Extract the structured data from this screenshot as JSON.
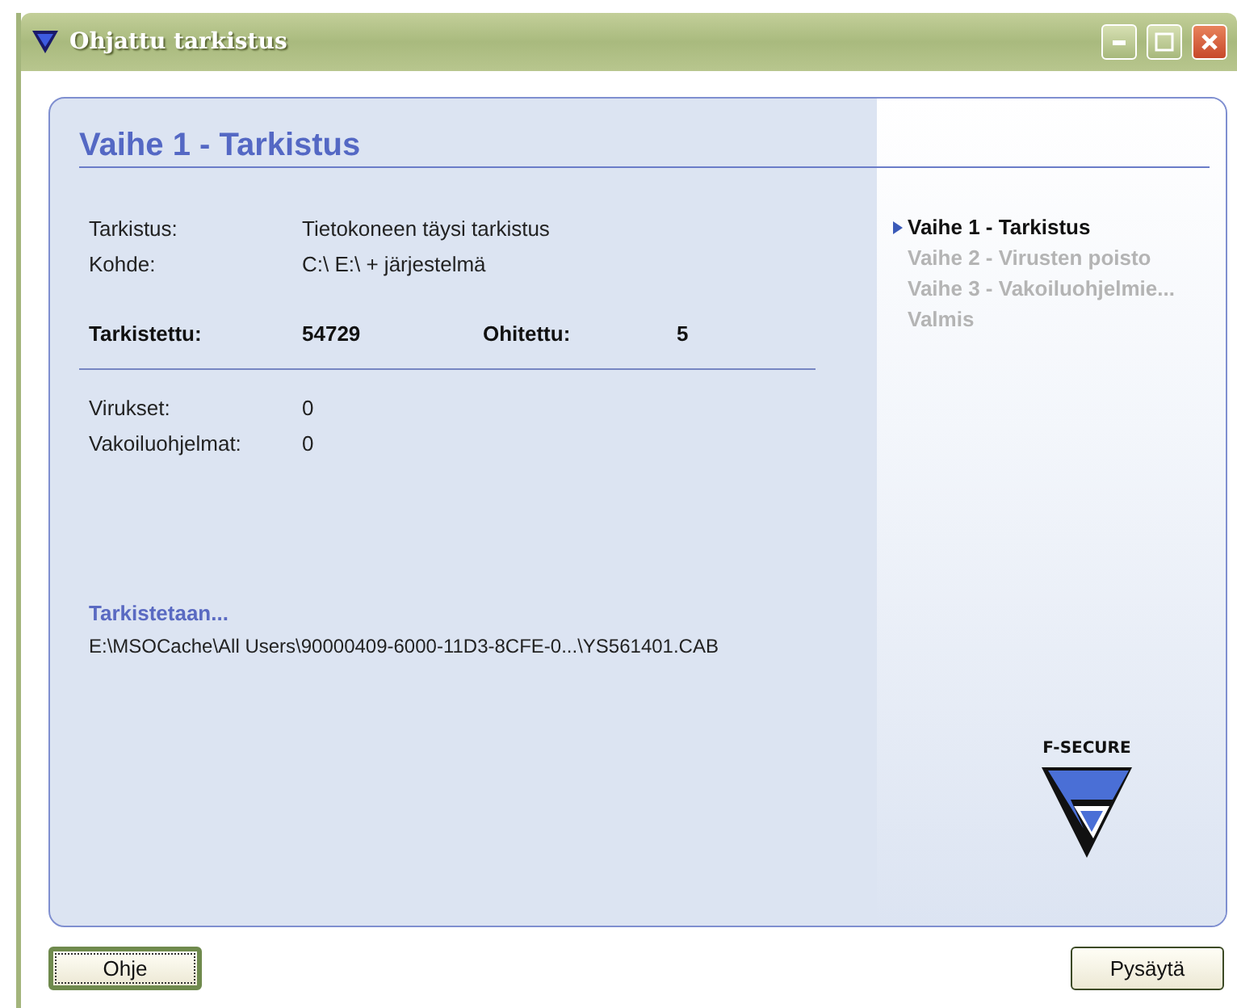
{
  "window": {
    "title": "Ohjattu tarkistus"
  },
  "page_title": "Vaihe 1 - Tarkistus",
  "scan_info": [
    {
      "label": "Tarkistus:",
      "value": "Tietokoneen täysi tarkistus"
    },
    {
      "label": "Kohde:",
      "value": "C:\\ E:\\  + järjestelmä"
    }
  ],
  "counts": {
    "scanned_label": "Tarkistettu:",
    "scanned": "54729",
    "skipped_label": "Ohitettu:",
    "skipped": "5"
  },
  "results": [
    {
      "label": "Virukset:",
      "value": "0"
    },
    {
      "label": "Vakoiluohjelmat:",
      "value": "0"
    }
  ],
  "status": {
    "heading": "Tarkistetaan...",
    "file": "E:\\MSOCache\\All Users\\90000409-6000-11D3-8CFE-0...\\YS561401.CAB"
  },
  "steps": [
    {
      "label": "Vaihe 1 - Tarkistus",
      "selected": true
    },
    {
      "label": "Vaihe 2 - Virusten poisto",
      "selected": false
    },
    {
      "label": "Vaihe 3 - Vakoiluohjelmie...",
      "selected": false
    },
    {
      "label": "Valmis",
      "selected": false
    }
  ],
  "logo": {
    "text": "F-SECURE"
  },
  "buttons": [
    {
      "label": "Ohje",
      "focused": true
    },
    {
      "label": "Pysäytä",
      "focused": false
    }
  ]
}
